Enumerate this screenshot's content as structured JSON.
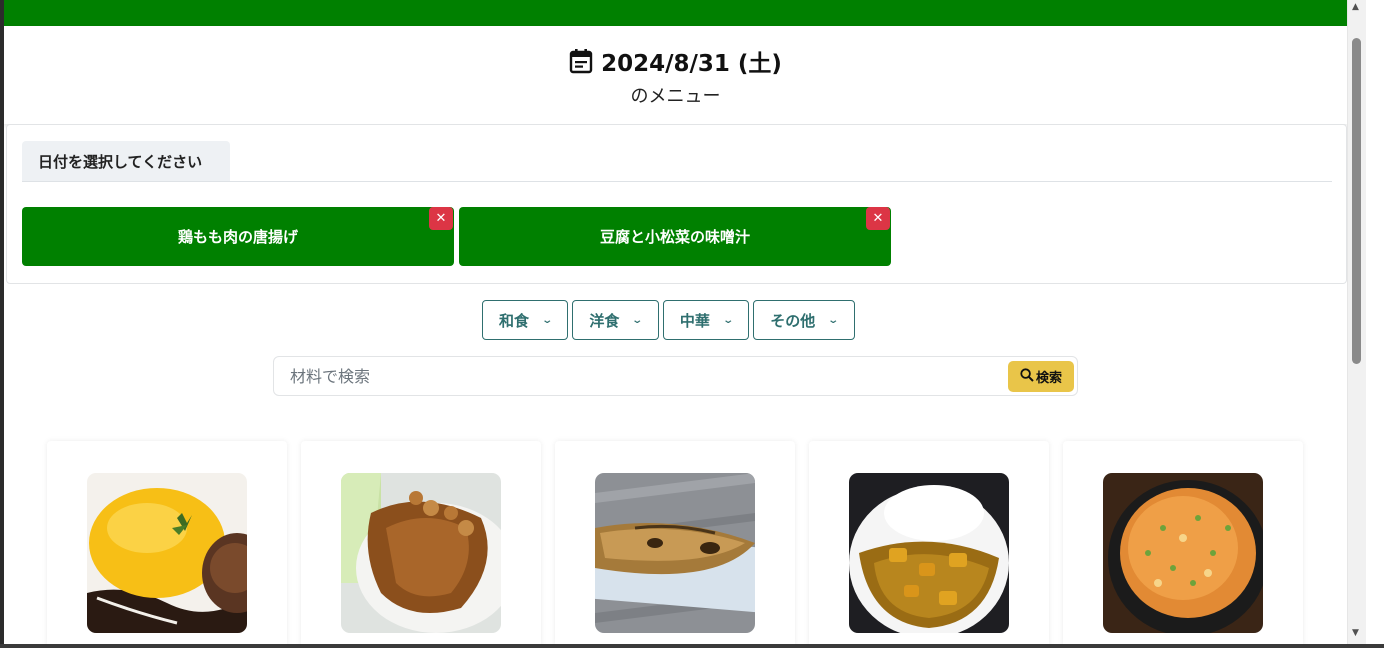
{
  "header": {
    "date": "2024/8/31 (土)",
    "subtitle": "のメニュー",
    "calendar_icon": "calendar-icon"
  },
  "selection": {
    "date_tab_label": "日付を選択してください",
    "dishes": [
      {
        "label": "鶏もも肉の唐揚げ",
        "remove": "✕"
      },
      {
        "label": "豆腐と小松菜の味噌汁",
        "remove": "✕"
      }
    ]
  },
  "categories": [
    {
      "label": "和食"
    },
    {
      "label": "洋食"
    },
    {
      "label": "中華"
    },
    {
      "label": "その他"
    }
  ],
  "search": {
    "placeholder": "材料で検索",
    "button_label": "検索",
    "icon": "search-icon"
  },
  "recipes": [
    {
      "image": "omurice-hamburg-photo"
    },
    {
      "image": "pork-ginger-photo"
    },
    {
      "image": "grilled-mackerel-photo"
    },
    {
      "image": "curry-rice-photo"
    },
    {
      "image": "fried-rice-photo"
    }
  ],
  "colors": {
    "brand_green": "#008000",
    "remove_red": "#dc3545",
    "category_teal": "#2f6f6f",
    "search_yellow": "#e9c549"
  }
}
